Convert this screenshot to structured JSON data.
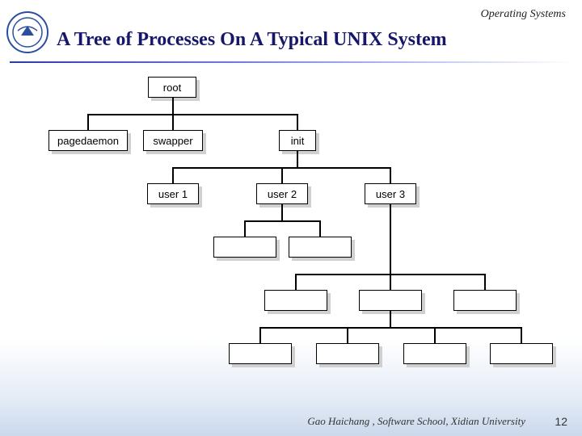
{
  "header": {
    "course": "Operating Systems",
    "title": "A Tree of Processes On A Typical UNIX System"
  },
  "footer": {
    "text": "Gao Haichang , Software School, Xidian University",
    "page": "12"
  },
  "chart_data": {
    "type": "tree",
    "title": "A Tree of Processes On A Typical UNIX System",
    "nodes": [
      {
        "id": "root",
        "label": "root",
        "parent": null
      },
      {
        "id": "pagedaemon",
        "label": "pagedaemon",
        "parent": "root"
      },
      {
        "id": "swapper",
        "label": "swapper",
        "parent": "root"
      },
      {
        "id": "init",
        "label": "init",
        "parent": "root"
      },
      {
        "id": "user1",
        "label": "user 1",
        "parent": "init"
      },
      {
        "id": "user2",
        "label": "user 2",
        "parent": "init"
      },
      {
        "id": "user3",
        "label": "user 3",
        "parent": "init"
      },
      {
        "id": "u2c1",
        "label": "",
        "parent": "user2"
      },
      {
        "id": "u2c2",
        "label": "",
        "parent": "user2"
      },
      {
        "id": "u3c1",
        "label": "",
        "parent": "user3"
      },
      {
        "id": "u3c2",
        "label": "",
        "parent": "user3"
      },
      {
        "id": "u3c3",
        "label": "",
        "parent": "user3"
      },
      {
        "id": "u3c2c1",
        "label": "",
        "parent": "u3c2"
      },
      {
        "id": "u3c2c2",
        "label": "",
        "parent": "u3c2"
      },
      {
        "id": "u3c2c3",
        "label": "",
        "parent": "u3c2"
      },
      {
        "id": "u3c2c4",
        "label": "",
        "parent": "u3c2"
      }
    ]
  }
}
